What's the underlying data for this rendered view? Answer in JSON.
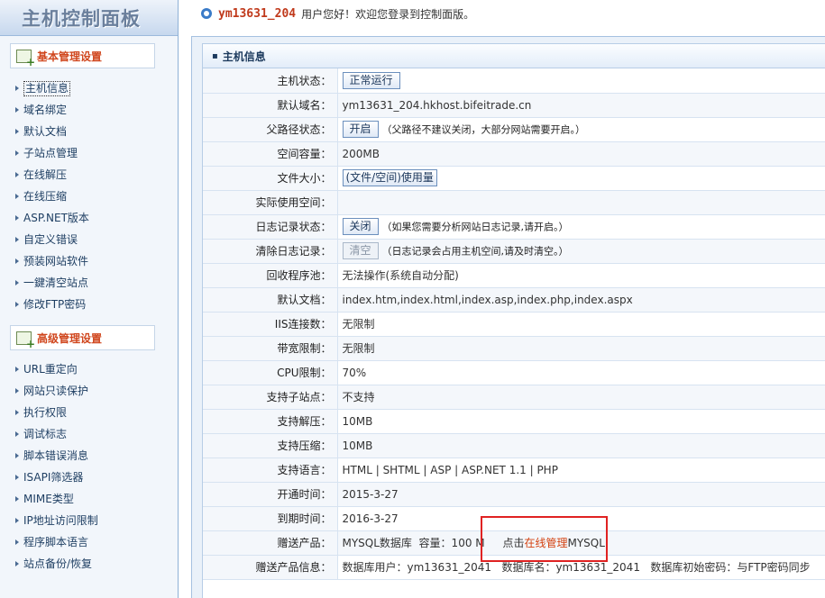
{
  "logo": {
    "title": "主机控制面板"
  },
  "topbar": {
    "username": "ym13631_204",
    "greeting": "用户您好！欢迎您登录到控制面版。"
  },
  "sidebar": {
    "sections": [
      {
        "title": "基本管理设置",
        "items": [
          "主机信息",
          "域名绑定",
          "默认文档",
          "子站点管理",
          "在线解压",
          "在线压缩",
          "ASP.NET版本",
          "自定义错误",
          "预装网站软件",
          "一鍵清空站点",
          "修改FTP密码"
        ]
      },
      {
        "title": "高级管理设置",
        "items": [
          "URL重定向",
          "网站只读保护",
          "执行权限",
          "调试标志",
          "脚本错误消息",
          "ISAPI筛选器",
          "MIME类型",
          "IP地址访问限制",
          "程序脚本语言",
          "站点备份/恢复"
        ]
      }
    ]
  },
  "panel": {
    "title": "主机信息",
    "rows": {
      "status": {
        "label": "主机状态：",
        "button": "正常运行"
      },
      "domain": {
        "label": "默认域名：",
        "value": "ym13631_204.hkhost.bifeitrade.cn"
      },
      "parent_path": {
        "label": "父路径状态：",
        "button": "开启",
        "note": "（父路径不建议关闭，大部分网站需要开启。）"
      },
      "capacity": {
        "label": "空间容量：",
        "value": "200MB"
      },
      "file_size": {
        "label": "文件大小：",
        "button": "(文件/空间)使用量"
      },
      "actual_usage": {
        "label": "实际使用空间：",
        "value": ""
      },
      "log_status": {
        "label": "日志记录状态：",
        "button": "关闭",
        "note": "（如果您需要分析网站日志记录,请开启。）"
      },
      "clear_log": {
        "label": "清除日志记录：",
        "button": "清空",
        "note": "（日志记录会占用主机空间,请及时清空。）"
      },
      "app_pool": {
        "label": "回收程序池：",
        "value": "无法操作(系统自动分配)"
      },
      "default_doc": {
        "label": "默认文档：",
        "value": "index.htm,index.html,index.asp,index.php,index.aspx"
      },
      "iis_conn": {
        "label": "IIS连接数：",
        "value": "无限制"
      },
      "bandwidth": {
        "label": "带宽限制：",
        "value": "无限制"
      },
      "cpu": {
        "label": "CPU限制：",
        "value": "70%"
      },
      "subsite": {
        "label": "支持子站点：",
        "value": "不支持"
      },
      "unzip": {
        "label": "支持解压：",
        "value": "10MB"
      },
      "zip": {
        "label": "支持压缩：",
        "value": "10MB"
      },
      "languages": {
        "label": "支持语言：",
        "value": "HTML | SHTML | ASP | ASP.NET 1.1 | PHP"
      },
      "open_date": {
        "label": "开通时间：",
        "value": "2015-3-27"
      },
      "expire_date": {
        "label": "到期时间：",
        "value": "2016-3-27"
      },
      "gift": {
        "label": "赠送产品：",
        "value": "MYSQL数据库  容量：100 M",
        "link_prefix": "点击",
        "link_text": "在线管理",
        "link_suffix": "MYSQL"
      },
      "gift_info": {
        "label": "赠送产品信息：",
        "value": "数据库用户：ym13631_2041   数据库名：ym13631_2041   数据库初始密码：与FTP密码同步"
      }
    }
  },
  "colors": {
    "accent_orange": "#d3410f",
    "highlight_red": "#e02222",
    "link_blue": "#1f3f63"
  }
}
